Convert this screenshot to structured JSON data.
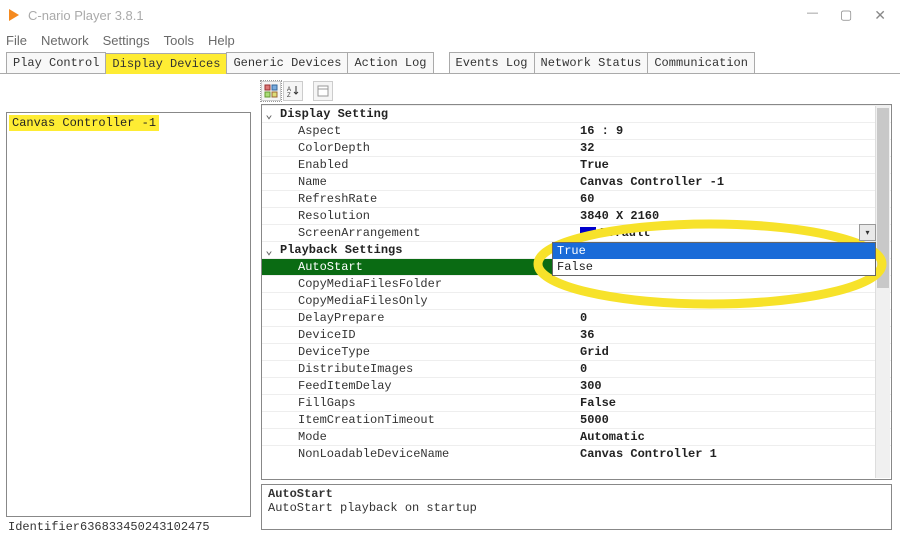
{
  "window": {
    "title": "C-nario Player 3.8.1"
  },
  "menubar": [
    "File",
    "Network",
    "Settings",
    "Tools",
    "Help"
  ],
  "tabs": [
    {
      "label": "Play Control",
      "active": false,
      "highlight": false
    },
    {
      "label": "Display Devices",
      "active": true,
      "highlight": true
    },
    {
      "label": "Generic Devices",
      "active": false,
      "highlight": false
    },
    {
      "label": "Action Log",
      "active": false,
      "highlight": false
    },
    {
      "label": "Events Log",
      "active": false,
      "highlight": false
    },
    {
      "label": "Network Status",
      "active": false,
      "highlight": false
    },
    {
      "label": "Communication",
      "active": false,
      "highlight": false
    }
  ],
  "tree": {
    "selected": "Canvas Controller -1"
  },
  "identifier": {
    "label": "Identifier",
    "value": "636833450243102475"
  },
  "toolbar_icons": [
    "categorize-icon",
    "alpha-sort-icon",
    "property-pages-icon"
  ],
  "propertygrid": {
    "categories": [
      {
        "name": "Display Setting",
        "rows": [
          {
            "name": "Aspect",
            "value": "16 : 9"
          },
          {
            "name": "ColorDepth",
            "value": "32"
          },
          {
            "name": "Enabled",
            "value": "True"
          },
          {
            "name": "Name",
            "value": "Canvas Controller -1"
          },
          {
            "name": "RefreshRate",
            "value": "60"
          },
          {
            "name": "Resolution",
            "value": "3840 X 2160"
          },
          {
            "name": "ScreenArrangement",
            "value": "Default",
            "colorchip": "#0000cc"
          }
        ]
      },
      {
        "name": "Playback Settings",
        "rows": [
          {
            "name": "AutoStart",
            "value": "True",
            "selected": true,
            "dropdown": {
              "options": [
                "True",
                "False"
              ],
              "selected": "True"
            }
          },
          {
            "name": "CopyMediaFilesFolder",
            "value": ""
          },
          {
            "name": "CopyMediaFilesOnly",
            "value": ""
          },
          {
            "name": "DelayPrepare",
            "value": "0"
          },
          {
            "name": "DeviceID",
            "value": "36"
          },
          {
            "name": "DeviceType",
            "value": "Grid"
          },
          {
            "name": "DistributeImages",
            "value": "0"
          },
          {
            "name": "FeedItemDelay",
            "value": "300"
          },
          {
            "name": "FillGaps",
            "value": "False"
          },
          {
            "name": "ItemCreationTimeout",
            "value": "5000"
          },
          {
            "name": "Mode",
            "value": "Automatic"
          },
          {
            "name": "NonLoadableDeviceName",
            "value": "Canvas Controller 1"
          }
        ]
      }
    ]
  },
  "description": {
    "title": "AutoStart",
    "text": "AutoStart playback on startup"
  }
}
